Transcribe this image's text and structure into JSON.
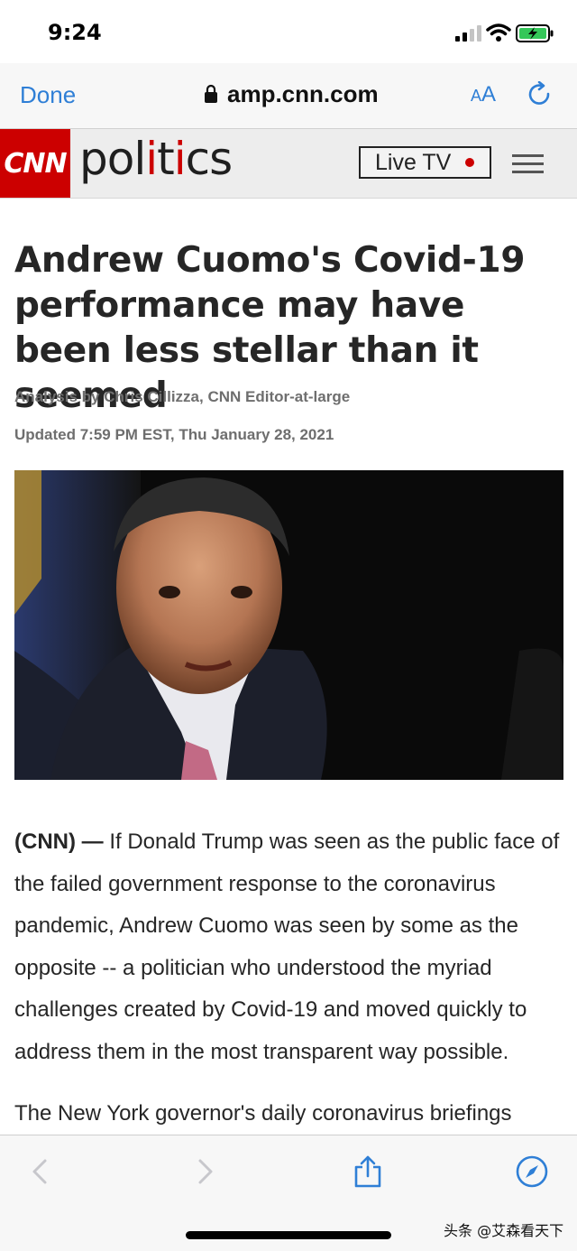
{
  "status": {
    "time": "9:24"
  },
  "browser": {
    "done_label": "Done",
    "url": "amp.cnn.com",
    "text_size_label_small": "A",
    "text_size_label_large": "A"
  },
  "header": {
    "logo_text": "CNN",
    "section_pre": "pol",
    "section_accent": "i",
    "section_mid": "t",
    "section_accent2": "i",
    "section_post": "cs",
    "live_tv_label": "Live TV"
  },
  "article": {
    "headline": "Andrew Cuomo's Covid-19 performance may have been less stellar than it seemed",
    "byline": "Analysis by Chris Cillizza, CNN Editor-at-large",
    "updated": "Updated 7:59 PM EST, Thu January 28, 2021",
    "dateline": "(CNN) —",
    "paragraph1": " If Donald Trump was seen as the public face of the failed government response to the coronavirus pandemic, Andrew Cuomo was seen by some as the opposite -- a politician who understood the myriad challenges created by Covid-19 and moved quickly to address them in the most transparent way possible.",
    "paragraph2": "The New York governor's daily coronavirus briefings"
  },
  "watermark": "头条 @艾森看天下",
  "colors": {
    "accent": "#cc0000",
    "link": "#2f7fd6"
  }
}
